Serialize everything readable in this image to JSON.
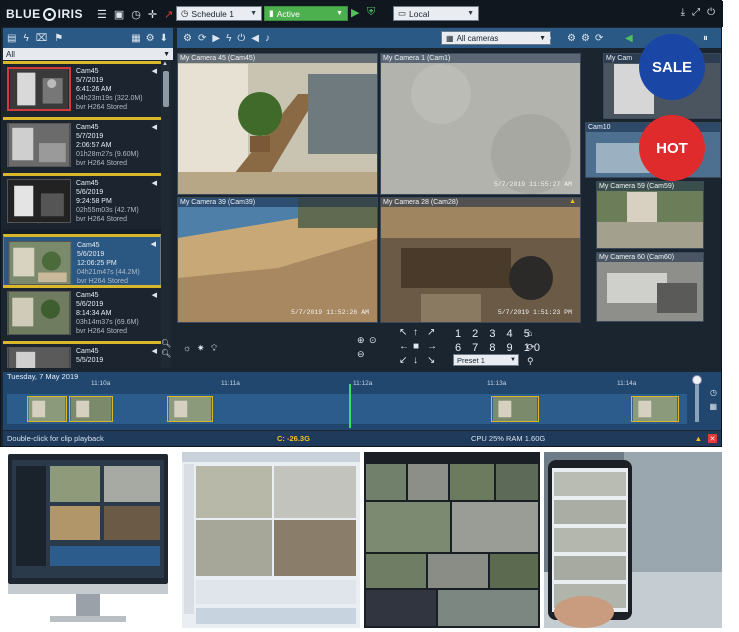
{
  "brand": {
    "logo_text_left": "BLUE",
    "logo_text_right": "IRIS"
  },
  "topbar": {
    "schedule": "Schedule 1",
    "profile": "Active",
    "server": "Local",
    "icons": [
      "list-icon",
      "window-icon",
      "clock-icon",
      "move-icon",
      "chart-icon",
      "help-icon"
    ],
    "right_icons": [
      "download-icon",
      "expand-icon",
      "power-icon"
    ]
  },
  "left_panel": {
    "filter": "All",
    "clips": [
      {
        "camera": "Cam45",
        "date": "5/7/2019",
        "time": "6:41:26 AM",
        "duration": "04h23m19s (322.0M)",
        "codec": "bvr H264 Stored",
        "selected": false
      },
      {
        "camera": "Cam45",
        "date": "5/7/2019",
        "time": "2:06:57 AM",
        "duration": "01h28m27s (9.60M)",
        "codec": "bvr H264 Stored",
        "selected": false
      },
      {
        "camera": "Cam45",
        "date": "5/6/2019",
        "time": "9:24:58 PM",
        "duration": "02h55m03s (42.7M)",
        "codec": "bvr H264 Stored",
        "selected": false
      },
      {
        "camera": "Cam45",
        "date": "5/6/2019",
        "time": "12:06:25 PM",
        "duration": "04h21m47s (44.2M)",
        "codec": "bvr H264 Stored",
        "selected": true
      },
      {
        "camera": "Cam45",
        "date": "5/6/2019",
        "time": "8:14:34 AM",
        "duration": "03h14m37s (69.6M)",
        "codec": "bvr H264 Stored",
        "selected": false
      },
      {
        "camera": "Cam45",
        "date": "5/5/2019",
        "time": "",
        "duration": "",
        "codec": "",
        "selected": false
      }
    ]
  },
  "view_toolbar": {
    "camera_group": "All cameras"
  },
  "cameras": [
    {
      "label": "My Camera 45 (Cam45)",
      "stamp": ""
    },
    {
      "label": "My Camera 1 (Cam1)",
      "stamp": "5/7/2019 11:55:27 AM"
    },
    {
      "label": "My Camera 39 (Cam39)",
      "stamp": "5/7/2019 11:52:26 AM"
    },
    {
      "label": "My Camera 28 (Cam28)",
      "stamp": "5/7/2019 1:51:23 PM"
    },
    {
      "label": "My Cam",
      "stamp": ""
    },
    {
      "label": "Cam10",
      "stamp": ""
    },
    {
      "label": "My Camera 59 (Cam59)",
      "stamp": ""
    },
    {
      "label": "My Camera 60 (Cam60)",
      "stamp": ""
    }
  ],
  "ptz": {
    "presets_row1": "1 2 3 4 5",
    "presets_row2": "6 7 8 9 10",
    "preset_select": "Preset 1"
  },
  "timeline": {
    "date": "Tuesday, 7 May 2019",
    "ticks": [
      "11:10a",
      "11:11a",
      "11:12a",
      "11:13a",
      "11:14a"
    ]
  },
  "status": {
    "hint": "Double-click for clip playback",
    "disk": "C: -26.3G",
    "cpu": "CPU 25% RAM 1.60G"
  },
  "badges": {
    "sale": "SALE",
    "hot": "HOT"
  },
  "colors": {
    "accent_blue": "#2a5986",
    "active_green": "#4db04f",
    "clip_yellow": "#d9b72b",
    "sale_blue": "#1a46a6",
    "hot_red": "#df2b2b"
  }
}
